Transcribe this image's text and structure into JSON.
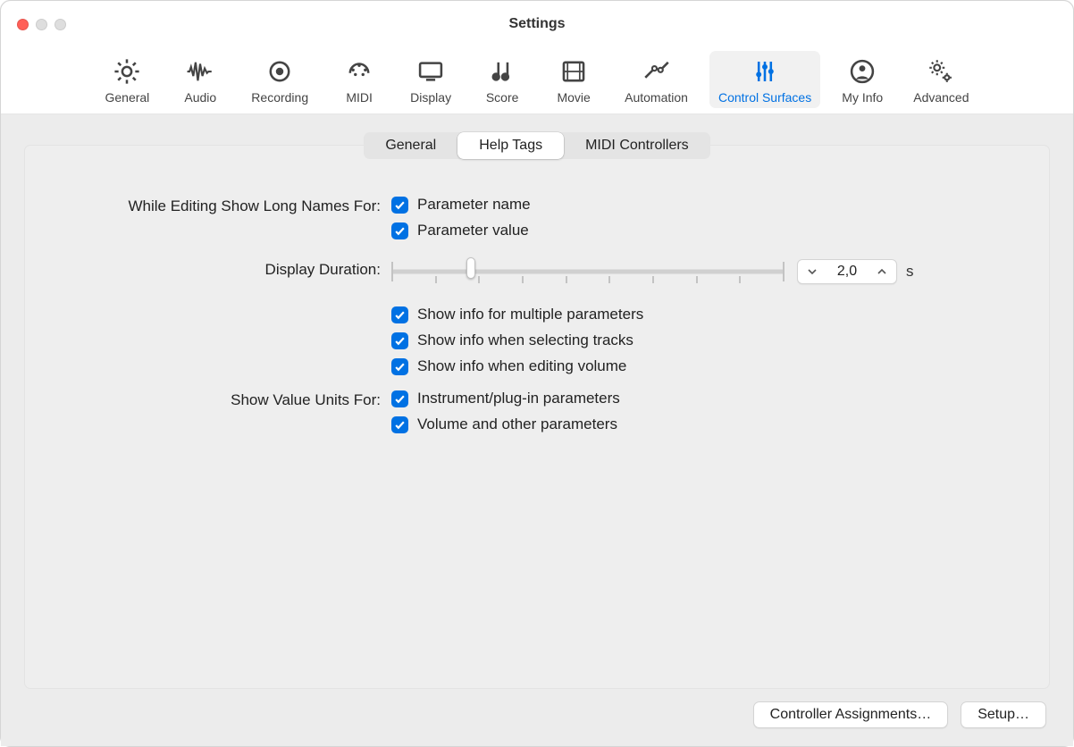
{
  "window": {
    "title": "Settings"
  },
  "toolbar": {
    "items": [
      {
        "id": "general",
        "label": "General"
      },
      {
        "id": "audio",
        "label": "Audio"
      },
      {
        "id": "recording",
        "label": "Recording"
      },
      {
        "id": "midi",
        "label": "MIDI"
      },
      {
        "id": "display",
        "label": "Display"
      },
      {
        "id": "score",
        "label": "Score"
      },
      {
        "id": "movie",
        "label": "Movie"
      },
      {
        "id": "automation",
        "label": "Automation"
      },
      {
        "id": "control-surfaces",
        "label": "Control Surfaces",
        "selected": true
      },
      {
        "id": "my-info",
        "label": "My Info"
      },
      {
        "id": "advanced",
        "label": "Advanced"
      }
    ]
  },
  "subtabs": {
    "items": [
      {
        "label": "General"
      },
      {
        "label": "Help Tags",
        "selected": true
      },
      {
        "label": "MIDI Controllers"
      }
    ]
  },
  "labels": {
    "while_editing": "While Editing Show Long Names For:",
    "display_duration": "Display Duration:",
    "show_value_units": "Show Value Units For:"
  },
  "options": {
    "parameter_name": {
      "label": "Parameter name",
      "checked": true
    },
    "parameter_value": {
      "label": "Parameter value",
      "checked": true
    },
    "multiple_params": {
      "label": "Show info for multiple parameters",
      "checked": true
    },
    "selecting_tracks": {
      "label": "Show info when selecting tracks",
      "checked": true
    },
    "editing_volume": {
      "label": "Show info when editing volume",
      "checked": true
    },
    "instrument_plugin": {
      "label": "Instrument/plug-in parameters",
      "checked": true
    },
    "volume_other": {
      "label": "Volume and other parameters",
      "checked": true
    }
  },
  "duration": {
    "value": "2,0",
    "unit": "s"
  },
  "footer": {
    "controller_assignments": "Controller Assignments…",
    "setup": "Setup…"
  }
}
